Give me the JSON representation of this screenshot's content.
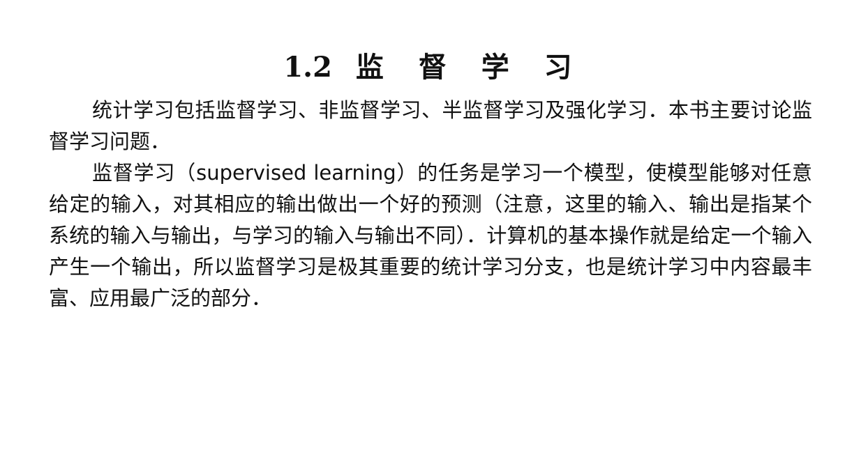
{
  "document": {
    "section_number": "1.2",
    "section_title": "监 督 学 习",
    "paragraphs": [
      "统计学习包括监督学习、非监督学习、半监督学习及强化学习．本书主要讨论监督学习问题．",
      "监督学习（supervised learning）的任务是学习一个模型，使模型能够对任意给定的输入，对其相应的输出做出一个好的预测（注意，这里的输入、输出是指某个系统的输入与输出，与学习的输入与输出不同）．计算机的基本操作就是给定一个输入产生一个输出，所以监督学习是极其重要的统计学习分支，也是统计学习中内容最丰富、应用最广泛的部分．"
    ]
  }
}
